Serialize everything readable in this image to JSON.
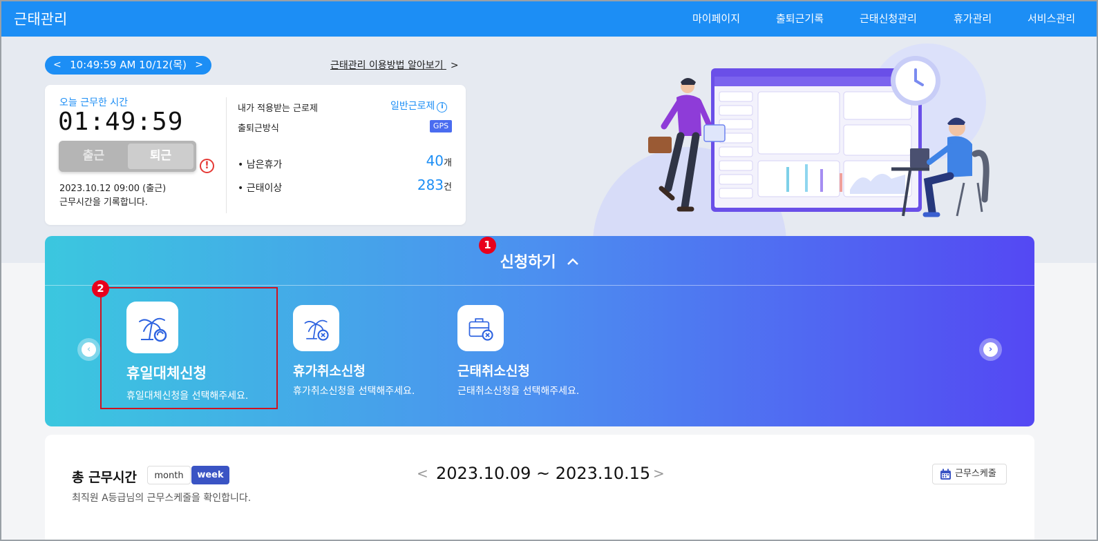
{
  "header": {
    "app_title": "근태관리",
    "nav": [
      "마이페이지",
      "출퇴근기록",
      "근태신청관리",
      "휴가관리",
      "서비스관리"
    ]
  },
  "date_bar": {
    "prev": "<",
    "datetime": "10:49:59 AM 10/12(목)",
    "next": ">"
  },
  "guide": {
    "label": "근태관리 이용방법 알아보기",
    "arrow": ">"
  },
  "today": {
    "label": "오늘 근무한 시간",
    "worked_time": "01:49:59",
    "check_in": "출근",
    "check_out": "퇴근",
    "alert": "!",
    "record": "2023.10.12 09:00 (출근)",
    "record_note": "근무시간을 기록합니다."
  },
  "policy": {
    "system_label": "내가 적용받는 근로제",
    "system_value": "일반근로제",
    "info": "i",
    "method_label": "출퇴근방식",
    "method_value": "GPS"
  },
  "stats": {
    "leave_label": "남은휴가",
    "leave_value": "40",
    "leave_unit": "개",
    "anomaly_label": "근태이상",
    "anomaly_value": "283",
    "anomaly_unit": "건"
  },
  "apply": {
    "title": "신청하기",
    "badge1": "1",
    "badge2": "2",
    "items": [
      {
        "title": "휴일대체신청",
        "desc": "휴일대체신청을 선택해주세요.",
        "icon": "palm-refresh-icon"
      },
      {
        "title": "휴가취소신청",
        "desc": "휴가취소신청을 선택해주세요.",
        "icon": "palm-cancel-icon"
      },
      {
        "title": "근태취소신청",
        "desc": "근태취소신청을 선택해주세요.",
        "icon": "briefcase-cancel-icon"
      }
    ]
  },
  "summary": {
    "title": "총 근무시간",
    "month": "month",
    "week": "week",
    "desc": "최직원 A등급님의 근무스케줄을 확인합니다.",
    "range": "2023.10.09 ~ 2023.10.15",
    "prev": "<",
    "next": ">",
    "schedule_button": "근무스케줄"
  },
  "colors": {
    "primary": "#1c8ef5",
    "gradient_start": "#3bc7df",
    "gradient_end": "#5448f3",
    "highlight": "#d0121f"
  }
}
